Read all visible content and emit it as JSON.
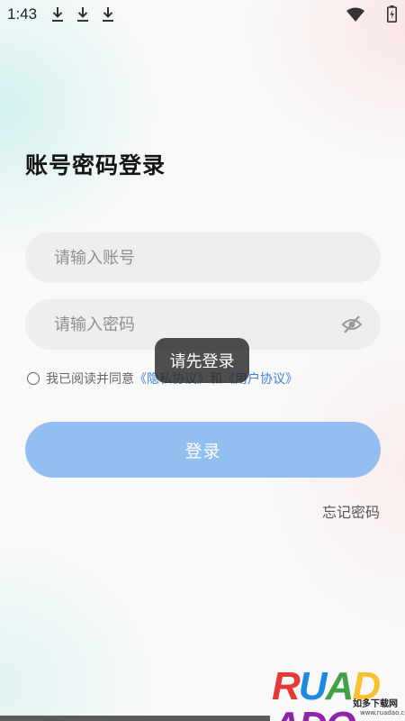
{
  "status_bar": {
    "time": "1:43",
    "icons": [
      "download-icon",
      "download-icon",
      "download-icon",
      "wifi-icon",
      "battery-icon"
    ]
  },
  "login": {
    "title": "账号密码登录",
    "account_placeholder": "请输入账号",
    "password_placeholder": "请输入密码",
    "password_toggle_icon": "eye-off-icon",
    "agreement": {
      "prefix": "我已阅读并同意",
      "privacy_link": "《隐私协议》",
      "conjunction": "和",
      "user_link": "《用户协议》"
    },
    "login_button": "登录",
    "forgot_password": "忘记密码"
  },
  "toast": {
    "message": "请先登录"
  },
  "watermark": {
    "logo_text": "RUADADO",
    "site_name": "如多下载网",
    "url": "www.ruadao.com"
  },
  "colors": {
    "primary_button": "#93bef0",
    "link": "#3f7ed8",
    "field_background": "#eeeeee",
    "toast_background": "#282828"
  }
}
